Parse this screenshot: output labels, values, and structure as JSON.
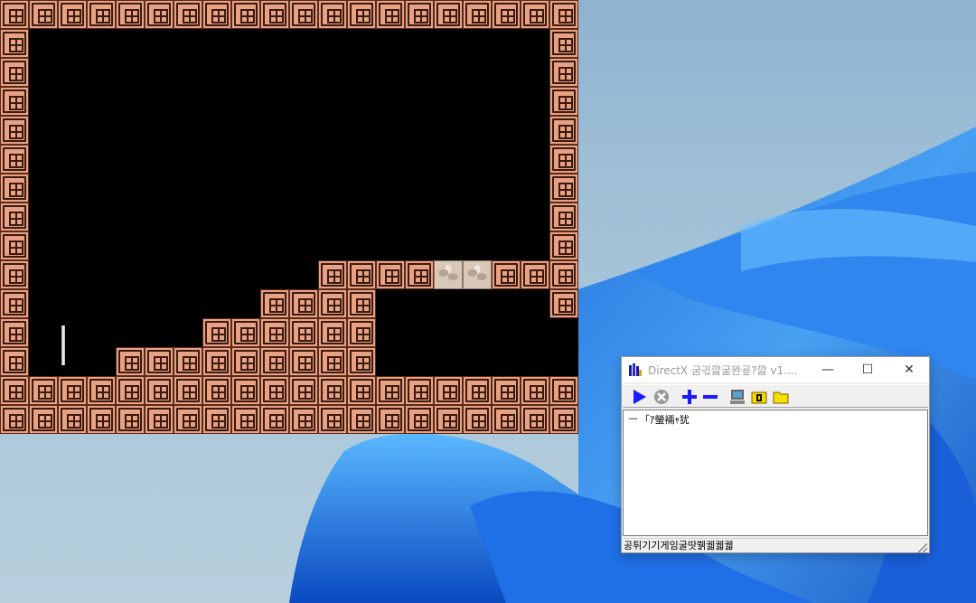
{
  "app_window": {
    "title": "DirectX 굼긗깛굶뫈굪?깛 v1....",
    "minimize_glyph": "—",
    "maximize_glyph": "☐",
    "close_glyph": "✕",
    "toolbar": {
      "buttons": [
        {
          "name": "play-button",
          "icon": "play-icon",
          "color": "#1a1aff"
        },
        {
          "name": "stop-button",
          "icon": "stop-circle-icon",
          "color": "#888888"
        },
        {
          "name": "add-button",
          "icon": "plus-icon",
          "color": "#1a1aff"
        },
        {
          "name": "remove-button",
          "icon": "minus-icon",
          "color": "#1a1aff"
        },
        {
          "name": "computer-button",
          "icon": "computer-icon",
          "color": "#555555"
        },
        {
          "name": "open-button",
          "icon": "folder-open-icon",
          "color": "#e6c800"
        },
        {
          "name": "folder-button",
          "icon": "folder-icon",
          "color": "#e6c800"
        }
      ]
    },
    "list": {
      "items": [
        {
          "dash": "—",
          "label": "「ｱ螢裲ｬ犹"
        }
      ]
    },
    "status_text": "공튀기기게임굴땃뷁궯궯궯"
  },
  "colors": {
    "brick": "#e8a283",
    "brick_outline": "#3a1a10",
    "game_bg": "#000000"
  }
}
